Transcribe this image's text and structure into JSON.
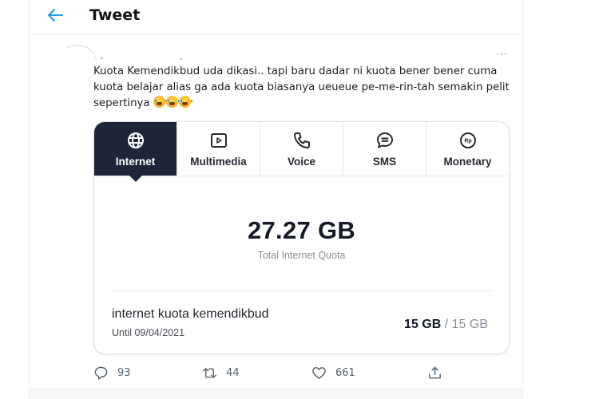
{
  "header": {
    "title": "Tweet",
    "back_icon": "arrow-left-icon"
  },
  "tweet": {
    "more_label": "···",
    "text": "Kuota Kemendikbud uda dikasi.. tapi baru dadar ni kuota bener bener cuma kuota belajar alias ga ada kuota biasanya ueueue pe-me-rin-tah semakin pelit sepertinya",
    "emojis": [
      "loudly-crying-face",
      "loudly-crying-face",
      "loudly-crying-face"
    ]
  },
  "card": {
    "tabs": [
      {
        "label": "Internet",
        "icon": "globe-icon",
        "active": true
      },
      {
        "label": "Multimedia",
        "icon": "play-icon",
        "active": false
      },
      {
        "label": "Voice",
        "icon": "phone-icon",
        "active": false
      },
      {
        "label": "SMS",
        "icon": "chat-icon",
        "active": false
      },
      {
        "label": "Monetary",
        "icon": "rupiah-icon",
        "active": false
      }
    ],
    "monetary_icon_text": "Rp",
    "total_value": "27.27 GB",
    "total_label": "Total Internet Quota",
    "package": {
      "name": "internet kuota kemendikbud",
      "until": "Until 09/04/2021",
      "used": "15 GB",
      "separator": " / ",
      "total": "15 GB"
    }
  },
  "actions": {
    "reply_count": "93",
    "retweet_count": "44",
    "like_count": "661"
  },
  "colors": {
    "accent": "#1d9bf0",
    "tab_active_bg": "#1e2538",
    "muted_text": "#536471"
  }
}
